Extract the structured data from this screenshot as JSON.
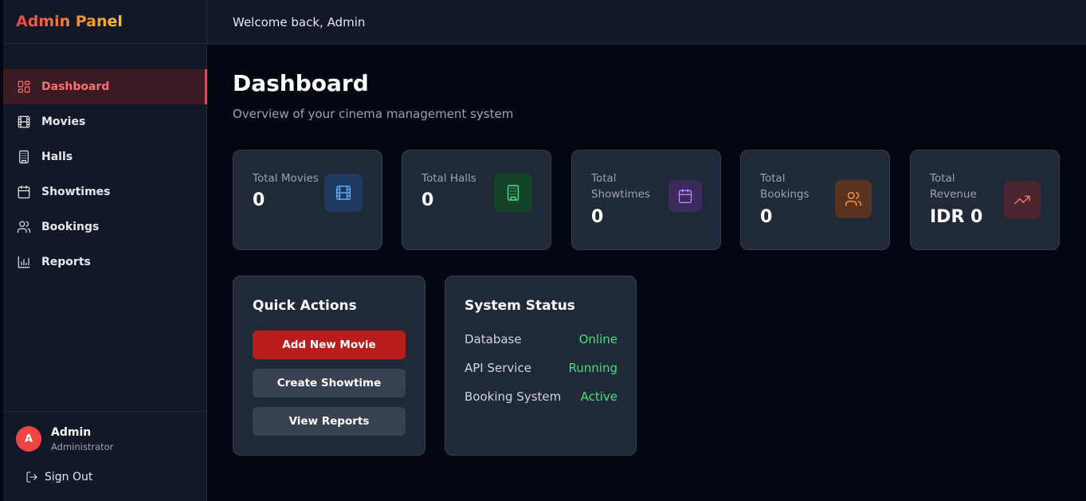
{
  "sidebar": {
    "brand": "Admin Panel",
    "items": [
      {
        "label": "Dashboard",
        "icon": "dashboard-icon",
        "active": true
      },
      {
        "label": "Movies",
        "icon": "film-icon"
      },
      {
        "label": "Halls",
        "icon": "building-icon"
      },
      {
        "label": "Showtimes",
        "icon": "calendar-icon"
      },
      {
        "label": "Bookings",
        "icon": "users-icon"
      },
      {
        "label": "Reports",
        "icon": "bar-chart-icon"
      }
    ],
    "user": {
      "initial": "A",
      "name": "Admin",
      "role": "Administrator"
    },
    "signout_label": "Sign Out"
  },
  "header": {
    "welcome": "Welcome back, Admin"
  },
  "main": {
    "title": "Dashboard",
    "subtitle": "Overview of your cinema management system",
    "stats": [
      {
        "label": "Total Movies",
        "value": "0",
        "icon": "film-icon",
        "color": "#60a5fa",
        "bg": "#1e3a5f"
      },
      {
        "label": "Total Halls",
        "value": "0",
        "icon": "building-icon",
        "color": "#4ade80",
        "bg": "#14432a"
      },
      {
        "label": "Total Showtimes",
        "value": "0",
        "icon": "calendar-icon",
        "color": "#c084fc",
        "bg": "#3b2a5c"
      },
      {
        "label": "Total Bookings",
        "value": "0",
        "icon": "users-icon",
        "color": "#fb923c",
        "bg": "#5a3320"
      },
      {
        "label": "Total Revenue",
        "value": "IDR 0",
        "icon": "trending-up-icon",
        "color": "#f87171",
        "bg": "#4a2530"
      }
    ],
    "quick_actions": {
      "title": "Quick Actions",
      "buttons": [
        "Add New Movie",
        "Create Showtime",
        "View Reports"
      ]
    },
    "system_status": {
      "title": "System Status",
      "rows": [
        {
          "name": "Database",
          "value": "Online"
        },
        {
          "name": "API Service",
          "value": "Running"
        },
        {
          "name": "Booking System",
          "value": "Active"
        }
      ]
    }
  },
  "colors": {
    "accent": "#ef4444",
    "status_ok": "#4ade80"
  }
}
